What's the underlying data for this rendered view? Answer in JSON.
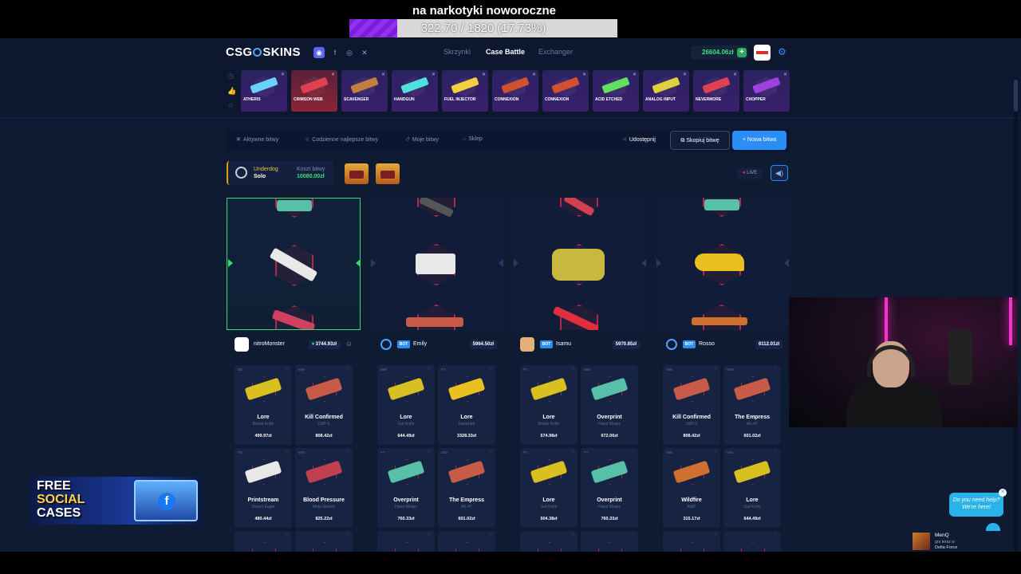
{
  "stream_goal": {
    "title": "na narkotyki noworoczne",
    "progress_text": "322.70 / 1820 (17.73%)",
    "progress_fraction": 0.1773
  },
  "header": {
    "logo_left": "CSG",
    "logo_right": "SKINS",
    "nav": [
      "Skrzynki",
      "Case Battle",
      "Exchanger"
    ],
    "active_nav": "Case Battle",
    "balance": "26604.06zł"
  },
  "live_drops": [
    {
      "name": "ATHERIS",
      "color": "#6ad0ff"
    },
    {
      "name": "CRIMSON WEB",
      "color": "#e04050"
    },
    {
      "name": "SCAVENGER",
      "color": "#c08040"
    },
    {
      "name": "HANDGUN",
      "color": "#50e0e0"
    },
    {
      "name": "FUEL INJECTOR",
      "color": "#f0d040"
    },
    {
      "name": "CONNEXION",
      "color": "#d05030"
    },
    {
      "name": "CONNEXION",
      "color": "#d05030"
    },
    {
      "name": "ACID ETCHED",
      "color": "#60e060"
    },
    {
      "name": "ANALOG INPUT",
      "color": "#e0d040"
    },
    {
      "name": "NEVERMORE",
      "color": "#e04050"
    },
    {
      "name": "CHOPPER",
      "color": "#a040e0"
    }
  ],
  "toolbar": {
    "active": "Aktywne bitwy",
    "daily": "Codzienne najlepsze bitwy",
    "mine": "Moje bitwy",
    "shop": "Sklep",
    "share": "Udostępnij",
    "copy": "Skopiuj bitwę",
    "new": "+ Nowa bitwa"
  },
  "battle": {
    "mode": "Underdog",
    "type": "Solo",
    "cost_label": "Koszt bitwy",
    "cost": "10080.00zł",
    "live": "LIVE"
  },
  "players": [
    {
      "name": "nitroMonster",
      "total": "3744.93zł",
      "bot": false,
      "items": [
        {
          "q": "BS",
          "name": "Lore",
          "sub": "Bowie Knife",
          "price": "499.97zł",
          "color": "#d8c020"
        },
        {
          "q": "MW",
          "name": "Kill Confirmed",
          "sub": "USP-S",
          "price": "808.42zł",
          "color": "#c85a48"
        },
        {
          "q": "FN",
          "name": "Printstream",
          "sub": "Desert Eagle",
          "price": "480.44zł",
          "color": "#e8e8e8"
        },
        {
          "q": "WW",
          "name": "Blood Pressure",
          "sub": "Moto Gloves",
          "price": "825.22zł",
          "color": "#c04050"
        }
      ]
    },
    {
      "name": "Emily",
      "total": "5964.50zł",
      "bot": true,
      "items": [
        {
          "q": "MW",
          "name": "Lore",
          "sub": "Gut Knife",
          "price": "644.49zł",
          "color": "#d8c020"
        },
        {
          "q": "FT",
          "name": "Lore",
          "sub": "Karambit",
          "price": "3328.33zł",
          "color": "#e8c020"
        },
        {
          "q": "FT",
          "name": "Overprint",
          "sub": "Hand Wraps",
          "price": "760.33zł",
          "color": "#58c0a8"
        },
        {
          "q": "MW",
          "name": "The Empress",
          "sub": "AK-47",
          "price": "601.02zł",
          "color": "#c85a48"
        }
      ]
    },
    {
      "name": "Isamu",
      "total": "5970.85zł",
      "bot": true,
      "items": [
        {
          "q": "FT",
          "name": "Lore",
          "sub": "Bowie Knife",
          "price": "574.98zł",
          "color": "#d8c020"
        },
        {
          "q": "WW",
          "name": "Overprint",
          "sub": "Hand Wraps",
          "price": "672.00zł",
          "color": "#58c0a8"
        },
        {
          "q": "FT",
          "name": "Lore",
          "sub": "Gut Knife",
          "price": "504.38zł",
          "color": "#d8c020"
        },
        {
          "q": "FT",
          "name": "Overprint",
          "sub": "Hand Wraps",
          "price": "760.33zł",
          "color": "#58c0a8"
        }
      ]
    },
    {
      "name": "Rosso",
      "total": "6112.01zł",
      "bot": true,
      "items": [
        {
          "q": "MW",
          "name": "Kill Confirmed",
          "sub": "USP-S",
          "price": "808.42zł",
          "color": "#c85a48"
        },
        {
          "q": "WW",
          "name": "The Empress",
          "sub": "AK-47",
          "price": "601.02zł",
          "color": "#c85a48"
        },
        {
          "q": "MW",
          "name": "Wildfire",
          "sub": "AWP",
          "price": "315.17zł",
          "color": "#d07030"
        },
        {
          "q": "MW",
          "name": "Lore",
          "sub": "Gut Knife",
          "price": "644.49zł",
          "color": "#d8c020"
        }
      ]
    }
  ],
  "promo": {
    "l1": "FREE",
    "l2": "SOCIAL",
    "l3": "CASES"
  },
  "help": {
    "l1": "Do you need help?",
    "l2": "We're here!"
  },
  "now_playing": {
    "user": "MenQ",
    "action": "gra teraz w",
    "game": "Delta Force"
  }
}
